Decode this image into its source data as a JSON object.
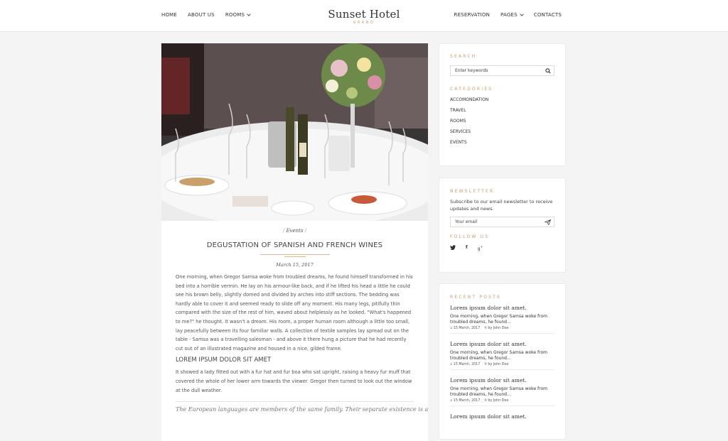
{
  "header": {
    "brand_name": "Sunset Hotel",
    "brand_sub": "GRAND",
    "nav_left": [
      "HOME",
      "ABOUT US",
      "ROOMS"
    ],
    "nav_right": [
      "RESERVATION",
      "PAGES",
      "CONTACTS"
    ]
  },
  "article": {
    "category": "Events",
    "title": "DEGUSTATION OF SPANISH AND FRENCH WINES",
    "date": "March 15, 2017",
    "paragraph1": "One morning, when Gregor Samsa woke from troubled dreams, he found himself transformed in his bed into a horrible vermin. He lay on his armour-like back, and if he lifted his head a little he could see his brown belly, slightly domed and divided by arches into stiff sections. The bedding was hardly able to cover it and seemed ready to slide off any moment. His many legs, pitifully thin compared with the size of the rest of him, waved about helplessly as he looked. \"What's happened to me?\" he thought. It wasn't a dream. His room, a proper human room although a little too small, lay peacefully between its four familiar walls. A collection of textile samples lay spread out on the table - Samsa was a travelling salesman - and above it there hung a picture that he had recently cut out of an illustrated magazine and housed in a nice, gilded frame.",
    "subheading": "LOREM IPSUM DOLOR SIT AMET",
    "paragraph2": "It showed a lady fitted out with a fur hat and fur boa who sat upright, raising a heavy fur muff that covered the whole of her lower arm towards the viewer. Gregor then turned to look out the window at the dull weather.",
    "quote": "The European languages are members of the same family. Their separate existence is a"
  },
  "sidebar": {
    "search_heading": "SEARCH",
    "search_placeholder": "Enter keywords",
    "categories_heading": "CATEGORIES",
    "categories": [
      "ACCOMONDATION",
      "TRAVEL",
      "ROOMS",
      "SERVICES",
      "EVENTS"
    ],
    "newsletter_heading": "NEWSLETTER",
    "newsletter_text": "Subscribe to our email newsletter to receive updates and news.",
    "email_placeholder": "Your email",
    "follow_heading": "FOLLOW US",
    "social_icons": [
      "twitter-icon",
      "facebook-icon",
      "google-plus-icon"
    ],
    "recent_heading": "RECENT POSTS",
    "recent_posts": [
      {
        "title": "Lorem ipsum dolor sit amet.",
        "excerpt": "One morning, when Gregor Samsa woke from troubled dreams, he found...",
        "date": "15 March, 2017",
        "author": "by John Doe"
      },
      {
        "title": "Lorem ipsum dolor sit amet.",
        "excerpt": "One morning, when Gregor Samsa woke from troubled dreams, he found...",
        "date": "15 March, 2017",
        "author": "by John Doe"
      },
      {
        "title": "Lorem ipsum dolor sit amet.",
        "excerpt": "One morning, when Gregor Samsa woke from troubled dreams, he found...",
        "date": "15 March, 2017",
        "author": "by John Doe"
      },
      {
        "title": "Lorem ipsum dolor sit amet.",
        "excerpt": "",
        "date": "",
        "author": ""
      }
    ]
  },
  "colors": {
    "accent": "#c89b6d",
    "background": "#f4f4f4"
  }
}
